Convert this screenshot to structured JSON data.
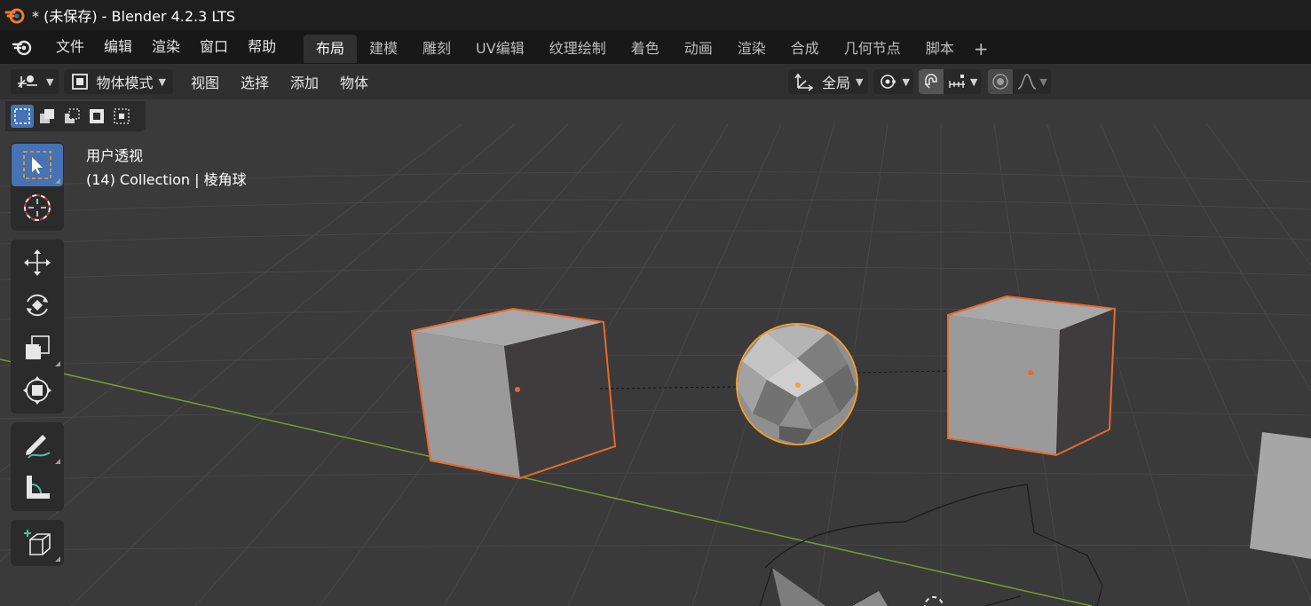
{
  "window": {
    "title": "* (未保存) - Blender 4.2.3 LTS"
  },
  "menu": [
    "文件",
    "编辑",
    "渲染",
    "窗口",
    "帮助"
  ],
  "workspaces": [
    {
      "label": "布局",
      "active": true
    },
    {
      "label": "建模",
      "active": false
    },
    {
      "label": "雕刻",
      "active": false
    },
    {
      "label": "UV编辑",
      "active": false
    },
    {
      "label": "纹理绘制",
      "active": false
    },
    {
      "label": "着色",
      "active": false
    },
    {
      "label": "动画",
      "active": false
    },
    {
      "label": "渲染",
      "active": false
    },
    {
      "label": "合成",
      "active": false
    },
    {
      "label": "几何节点",
      "active": false
    },
    {
      "label": "脚本",
      "active": false
    }
  ],
  "header": {
    "mode": "物体模式",
    "menus": [
      "视图",
      "选择",
      "添加",
      "物体"
    ],
    "orientation": "全局"
  },
  "viewport": {
    "view_name": "用户透视",
    "collection_info": "(14) Collection | 棱角球"
  },
  "colors": {
    "active_tool": "#4772b3",
    "selection_outline": "#e8692a",
    "active_outline": "#f0a030",
    "x_axis_line": "#7a9a2c"
  },
  "icons": {
    "workspace_add": "+"
  }
}
